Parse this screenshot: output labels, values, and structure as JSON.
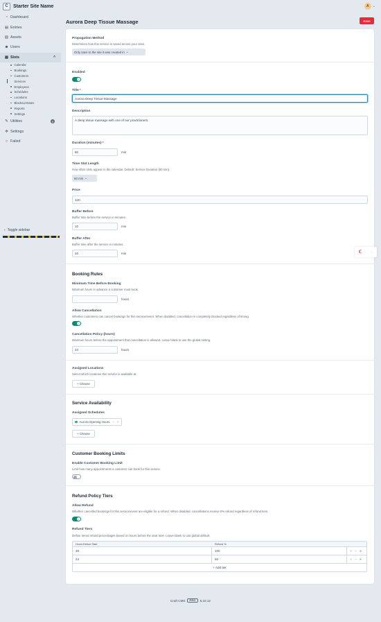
{
  "header": {
    "site_name": "Starter Site Name",
    "logo_letter": "C",
    "avatar_letter": "A"
  },
  "sidebar": {
    "items": [
      {
        "label": "Dashboard",
        "icon": "speedometer-icon",
        "glyph": "◔"
      },
      {
        "label": "Entries",
        "icon": "entries-icon",
        "glyph": "▤"
      },
      {
        "label": "Assets",
        "icon": "image-icon",
        "glyph": "▨"
      },
      {
        "label": "Users",
        "icon": "users-icon",
        "glyph": "☻"
      },
      {
        "label": "Slots",
        "icon": "calendar-icon",
        "glyph": "▦"
      }
    ],
    "slots_sub": [
      "Calendar",
      "Bookings",
      "Customers",
      "Services",
      "Employees",
      "Schedules",
      "Locations",
      "Blackout Dates",
      "Reports",
      "Settings"
    ],
    "utilities": {
      "label": "Utilities",
      "badge": "9"
    },
    "settings": {
      "label": "Settings"
    },
    "failed": {
      "label": "Failed"
    },
    "toggle": "Toggle sidebar"
  },
  "page": {
    "title": "Aurora Deep Tissue Massage",
    "save": "Save"
  },
  "form": {
    "propagation": {
      "label": "Propagation Method",
      "instructions": "Determines how this service is saved across your sites.",
      "value": "Only save to the site it was created in"
    },
    "enabled": {
      "label": "Enabled",
      "on": true
    },
    "title": {
      "label": "Title",
      "value": "Aurora Deep Tissue Massage"
    },
    "description": {
      "label": "Description",
      "value": "A deep tissue massage with one of our practitioners."
    },
    "duration": {
      "label": "Duration (minutes)",
      "value": "60",
      "unit": "min"
    },
    "slot_length": {
      "label": "Time Slot Length",
      "instructions": "How often slots appear in the calendar. Default: Service Duration (60 min).",
      "value": "60 min"
    },
    "price": {
      "label": "Price",
      "value": "120"
    },
    "buffer_before": {
      "label": "Buffer Before",
      "instructions": "Buffer time before the service in minutes.",
      "value": "10",
      "unit": "min"
    },
    "buffer_after": {
      "label": "Buffer After",
      "instructions": "Buffer time after the service in minutes.",
      "value": "10",
      "unit": "min"
    }
  },
  "booking_rules": {
    "heading": "Booking Rules",
    "min_time": {
      "label": "Minimum Time Before Booking",
      "instructions": "Minimum hours in advance a customer must book.",
      "value": "",
      "unit": "hours"
    },
    "allow_cancel": {
      "label": "Allow Cancellation",
      "instructions": "Whether customers can cancel bookings for this service/event. When disabled, cancellation is completely blocked regardless of timing.",
      "on": true
    },
    "cancel_policy": {
      "label": "Cancellation Policy (hours)",
      "instructions": "Minimum hours before the appointment that cancellation is allowed. Leave blank to use the global setting.",
      "value": "24",
      "unit": "hours"
    }
  },
  "locations": {
    "label": "Assigned Locations",
    "instructions": "Select which locations this service is available at.",
    "button": "+ Choose"
  },
  "availability": {
    "heading": "Service Availability",
    "label": "Assigned Schedules",
    "chip": "Aurora Opening Hours",
    "button": "+ Choose"
  },
  "limits": {
    "heading": "Customer Booking Limits",
    "label": "Enable Customer Booking Limit",
    "instructions": "Limit how many appointments a customer can book for this service.",
    "on": false
  },
  "refund": {
    "heading": "Refund Policy Tiers",
    "allow": {
      "label": "Allow Refund",
      "instructions": "Whether cancelled bookings for this service/event are eligible for a refund. When disabled, cancellations receive 0% refund regardless of refund tiers.",
      "on": true
    },
    "tiers": {
      "label": "Refund Tiers",
      "instructions": "Define tiered refund percentages based on hours before the start time. Leave blank to use global default.",
      "columns": [
        "Hours Before Start",
        "Refund %"
      ],
      "rows": [
        [
          "48",
          "100"
        ],
        [
          "24",
          "50"
        ]
      ],
      "add": "+ Add tier"
    }
  },
  "footer": {
    "product": "Craft CMS",
    "edition": "PRO",
    "version": "5.10.12"
  },
  "colors": {
    "accent": "#e12d39",
    "toggle_on": "#0b8b73",
    "focus": "#2b8ac1"
  }
}
